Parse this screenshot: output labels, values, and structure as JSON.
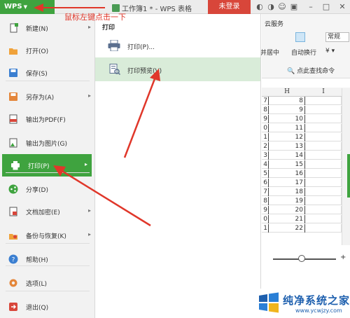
{
  "titlebar": {
    "app_button": "WPS",
    "doc_title": "工作簿1 * - WPS 表格",
    "login_label": "未登录"
  },
  "annotation": {
    "text": "鼠标左键点击一下"
  },
  "ribbon": {
    "cloud_tab": "云服务",
    "style_dropdown": "常规",
    "merge_label": "并居中",
    "wrap_label": "自动换行",
    "search_label": "点此查找命令"
  },
  "sheet": {
    "col_h": "H",
    "col_i": "I",
    "rows": [
      {
        "g": "7",
        "h": "8"
      },
      {
        "g": "8",
        "h": "9"
      },
      {
        "g": "9",
        "h": "10"
      },
      {
        "g": "0",
        "h": "11"
      },
      {
        "g": "1",
        "h": "12"
      },
      {
        "g": "2",
        "h": "13"
      },
      {
        "g": "3",
        "h": "14"
      },
      {
        "g": "4",
        "h": "15"
      },
      {
        "g": "5",
        "h": "16"
      },
      {
        "g": "6",
        "h": "17"
      },
      {
        "g": "7",
        "h": "18"
      },
      {
        "g": "8",
        "h": "19"
      },
      {
        "g": "9",
        "h": "20"
      },
      {
        "g": "0",
        "h": "21"
      },
      {
        "g": "1",
        "h": "22"
      }
    ]
  },
  "menu": {
    "items": [
      {
        "label": "新建(N)",
        "icon": "new-doc-icon"
      },
      {
        "label": "打开(O)",
        "icon": "folder-icon"
      },
      {
        "label": "保存(S)",
        "icon": "save-icon"
      },
      {
        "label": "另存为(A)",
        "icon": "save-as-icon"
      },
      {
        "label": "输出为PDF(F)",
        "icon": "pdf-icon"
      },
      {
        "label": "输出为图片(G)",
        "icon": "image-icon"
      },
      {
        "label": "打印(P)",
        "icon": "printer-icon"
      },
      {
        "label": "分享(D)",
        "icon": "share-icon"
      },
      {
        "label": "文档加密(E)",
        "icon": "lock-icon"
      },
      {
        "label": "备份与恢复(K)",
        "icon": "backup-icon"
      },
      {
        "label": "帮助(H)",
        "icon": "help-icon"
      },
      {
        "label": "选项(L)",
        "icon": "gear-icon"
      },
      {
        "label": "退出(Q)",
        "icon": "exit-icon"
      }
    ]
  },
  "submenu": {
    "title": "打印",
    "print_label": "打印(P)...",
    "preview_label": "打印预览(V)"
  },
  "watermark": {
    "title": "纯净系统之家",
    "url": "www.ycwjzy.com"
  },
  "colors": {
    "accent_green": "#3fa33f",
    "login_red": "#d8463a",
    "annotation_red": "#e0372a",
    "preview_highlight": "#d9ecd9"
  }
}
